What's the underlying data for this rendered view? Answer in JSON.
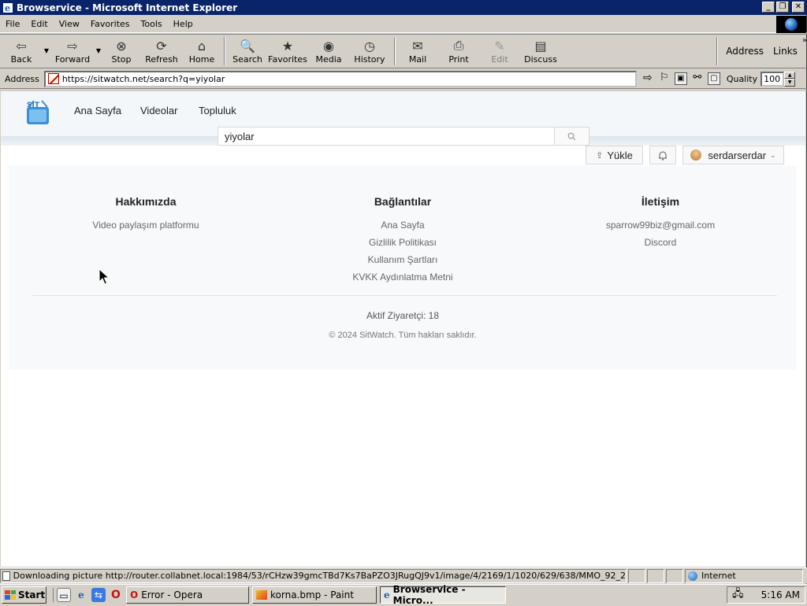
{
  "window": {
    "title": "Browservice - Microsoft Internet Explorer",
    "controls": [
      "_",
      "❐",
      "✕"
    ]
  },
  "menu": [
    "File",
    "Edit",
    "View",
    "Favorites",
    "Tools",
    "Help"
  ],
  "toolbar": {
    "back": "Back",
    "forward": "Forward",
    "stop": "Stop",
    "refresh": "Refresh",
    "home": "Home",
    "search": "Search",
    "favorites": "Favorites",
    "media": "Media",
    "history": "History",
    "mail": "Mail",
    "print": "Print",
    "edit": "Edit",
    "discuss": "Discuss",
    "address_label": "Address",
    "links_label": "Links"
  },
  "address_bar": {
    "label": "Address",
    "url": "https://sitwatch.net/search?q=yiyolar",
    "quality_label": "Quality",
    "quality_value": "100"
  },
  "site": {
    "nav": [
      "Ana Sayfa",
      "Videolar",
      "Topluluk"
    ],
    "search_value": "yiyolar",
    "upload": "Yükle",
    "username": "serdarserdar",
    "footer": {
      "about_title": "Hakkımızda",
      "about_text": "Video paylaşım platformu",
      "links_title": "Bağlantılar",
      "links": [
        "Ana Sayfa",
        "Gizlilik Politikası",
        "Kullanım Şartları",
        "KVKK Aydınlatma Metni"
      ],
      "contact_title": "İletişim",
      "email": "sparrow99biz@gmail.com",
      "discord": "Discord",
      "visitors": "Aktif Ziyaretçi: 18",
      "copyright": "© 2024 SitWatch. Tüm hakları saklıdır."
    }
  },
  "status": {
    "text": "Downloading picture http://router.collabnet.local:1984/53/rCHzw39gmcTBd7Ks7BaPZO3JRugQJ9v1/image/4/2169/1/1020/629/638/MMO_92_2",
    "zone": "Internet"
  },
  "taskbar": {
    "start": "Start",
    "tasks": [
      "Error - Opera",
      "korna.bmp - Paint",
      "Browservice - Micro..."
    ],
    "clock": "5:16 AM"
  }
}
